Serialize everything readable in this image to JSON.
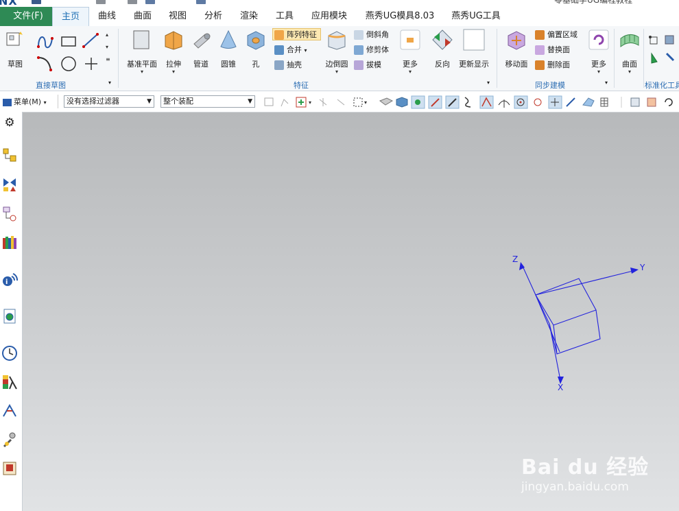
{
  "app": {
    "logo": "NX",
    "window_title": "零基础学UG编程教程"
  },
  "tabs": [
    "文件(F)",
    "主页",
    "曲线",
    "曲面",
    "视图",
    "分析",
    "渲染",
    "工具",
    "应用模块",
    "燕秀UG模具8.03",
    "燕秀UG工具"
  ],
  "ribbon": {
    "sketch": {
      "label": "草图"
    },
    "direct_sketch_group": "直接草图",
    "feature_buttons": [
      "基准平面",
      "拉伸",
      "管道",
      "圆锥",
      "孔"
    ],
    "feature_small": [
      "阵列特征",
      "合并",
      "抽壳"
    ],
    "edge_blend": "边倒圆",
    "feature_small2": [
      "倒斜角",
      "修剪体",
      "拔模"
    ],
    "more1": "更多",
    "reverse": "反向",
    "update_display": "更新显示",
    "feature_group": "特征",
    "move_face": "移动面",
    "sync_small": [
      "偏置区域",
      "替换面",
      "删除面"
    ],
    "more2": "更多",
    "sync_group": "同步建模",
    "surface": "曲面",
    "std_group": "标准化工具"
  },
  "toolbar": {
    "menu": "菜单(M)",
    "filter": "没有选择过滤器",
    "assembly": "整个装配"
  },
  "triad": {
    "x": "X",
    "y": "Y",
    "z": "Z"
  },
  "watermark": {
    "brand": "Bai du 经验",
    "url": "jingyan.baidu.com"
  }
}
